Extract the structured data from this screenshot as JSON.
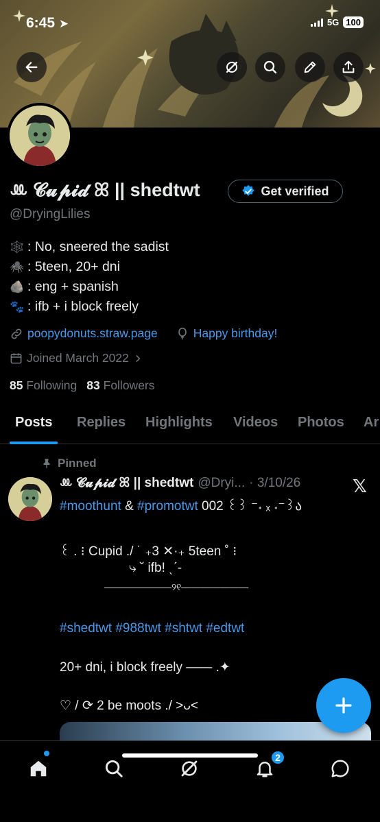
{
  "status": {
    "time": "6:45",
    "network": "5G",
    "battery": "100"
  },
  "profile": {
    "display_name": "ꔛ 𝓒𝓾𝓹𝓲𝓭 ꕤ || shedtwt",
    "verify_label": "Get verified",
    "handle": "@DryingLilies",
    "bio": [
      {
        "emoji": "🕸️",
        "text": ": No, sneered the sadist"
      },
      {
        "emoji": "🕷️",
        "text": ": 5teen, 20+ dni"
      },
      {
        "emoji": "🪨",
        "text": ": eng + spanish"
      },
      {
        "emoji": "🐾",
        "text": ": ifb + i block freely"
      }
    ],
    "link": "poopydonuts.straw.page",
    "birthday": "Happy birthday!",
    "joined": "Joined March 2022",
    "following_count": "85",
    "following_label": "Following",
    "followers_count": "83",
    "followers_label": "Followers"
  },
  "tabs": [
    "Posts",
    "Replies",
    "Highlights",
    "Videos",
    "Photos",
    "Ar"
  ],
  "pinned_tweet": {
    "pinned_label": "Pinned",
    "name": "ꔛ 𝓒𝓾𝓹𝓲𝓭 ꕤ || shedtwt",
    "handle": "@Dryi...",
    "date": "· 3/10/26",
    "line1_hash1": "#moothunt",
    "line1_amp": "&",
    "line1_hash2": "#promotwt",
    "line1_rest": "002 ꒰꒱ ⁻˖ ₓ ˖⁻꒱ა",
    "line2": "꒰ . ⁝ Cupid ./ ˙ ₊3 ✕·₊ 5teen ˚ ⁝",
    "line3": "⤷ ˘ ifb! ˎˊ-",
    "line4": "———————୨୧———————",
    "tags": "#shedtwt #988twt #shtwt #edtwt",
    "line5": "20+ dni, i block freely —— .✦",
    "line6": "♡ / ⟳ 2 be moots ./ >ᴗ<"
  },
  "nav": {
    "notifications_badge": "2"
  },
  "colors": {
    "accent": "#1d9bf0",
    "link": "#4a99e9",
    "muted": "#71767b"
  }
}
